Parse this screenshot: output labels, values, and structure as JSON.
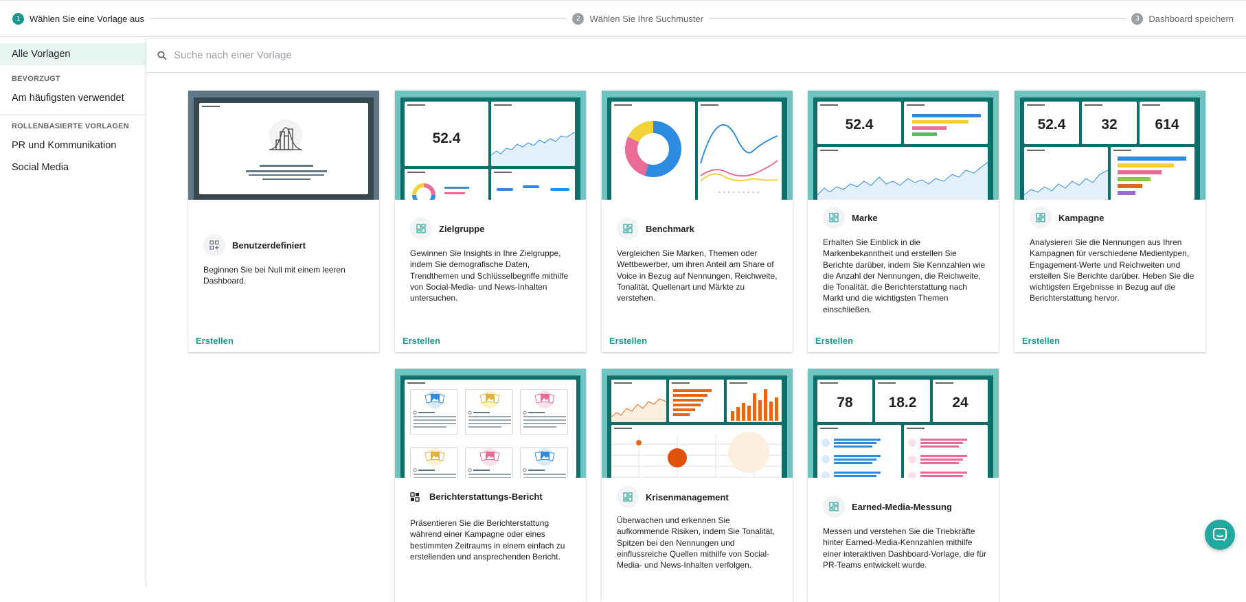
{
  "stepper": [
    {
      "num": "1",
      "label": "Wählen Sie eine Vorlage aus"
    },
    {
      "num": "2",
      "label": "Wählen Sie Ihre Suchmuster"
    },
    {
      "num": "3",
      "label": "Dashboard speichern"
    }
  ],
  "sidebar": {
    "all": "Alle Vorlagen",
    "fav_head": "BEVORZUGT",
    "most_used": "Am häufigsten verwendet",
    "role_head": "ROLLENBASIERTE VORLAGEN",
    "items": [
      "PR und Kommunikation",
      "Social Media"
    ]
  },
  "search": {
    "placeholder": "Suche nach einer Vorlage"
  },
  "create_label": "Erstellen",
  "cards": [
    {
      "title": "Benutzerdefiniert",
      "desc": "Beginnen Sie bei Null mit einem leeren Dashboard."
    },
    {
      "title": "Zielgruppe",
      "desc": "Gewinnen Sie Insights in Ihre Zielgruppe, indem Sie demografische Daten, Trendthemen und Schlüsselbegriffe mithilfe von Social-Media- und News-Inhalten untersuchen.",
      "kpi": "52.4"
    },
    {
      "title": "Benchmark",
      "desc": "Vergleichen Sie Marken, Themen oder Wettbewerber, um ihren Anteil am Share of Voice in Bezug auf Nennungen, Reichweite, Tonalität, Quellenart und Märkte zu verstehen."
    },
    {
      "title": "Marke",
      "desc": "Erhalten Sie Einblick in die Markenbekanntheit und erstellen Sie Berichte darüber, indem Sie Kennzahlen wie die Anzahl der Nennungen, die Reichweite, die Tonalität, die Berichterstattung nach Markt und die wichtigsten Themen einschließen.",
      "kpi": "52.4"
    },
    {
      "title": "Kampagne",
      "desc": "Analysieren Sie die Nennungen aus Ihren Kampagnen für verschiedene Medientypen, Engagement-Werte und Reichweiten und erstellen Sie Berichte darüber. Heben Sie die wichtigsten Ergebnisse in Bezug auf die Berichterstattung hervor.",
      "kpis": [
        "52.4",
        "32",
        "614"
      ]
    },
    {
      "title": "Berichterstattungs-Bericht",
      "desc": "Präsentieren Sie die Berichterstattung während einer Kampagne oder eines bestimmten Zeitraums in einem einfach zu erstellenden und ansprechenden Bericht."
    },
    {
      "title": "Krisenmanagement",
      "desc": "Überwachen und erkennen Sie aufkommende Risiken, indem Sie Tonalität, Spitzen bei den Nennungen und einflussreiche Quellen mithilfe von Social-Media- und News-Inhalten verfolgen."
    },
    {
      "title": "Earned-Media-Messung",
      "desc": "Messen und verstehen Sie die Triebkräfte hinter Earned-Media-Kennzahlen mithilfe einer interaktiven Dashboard-Vorlage, die für PR-Teams entwickelt wurde.",
      "kpis": [
        "78",
        "18.2",
        "24"
      ]
    }
  ],
  "colors": {
    "accent": "#1a9a8f",
    "frame": "#0c6f6a",
    "preview_bg": "#70c4c0",
    "blue": "#2d8be0",
    "yellow": "#f2d43a",
    "pink": "#ea6a98",
    "green": "#5cb85c",
    "orange": "#e86612"
  }
}
